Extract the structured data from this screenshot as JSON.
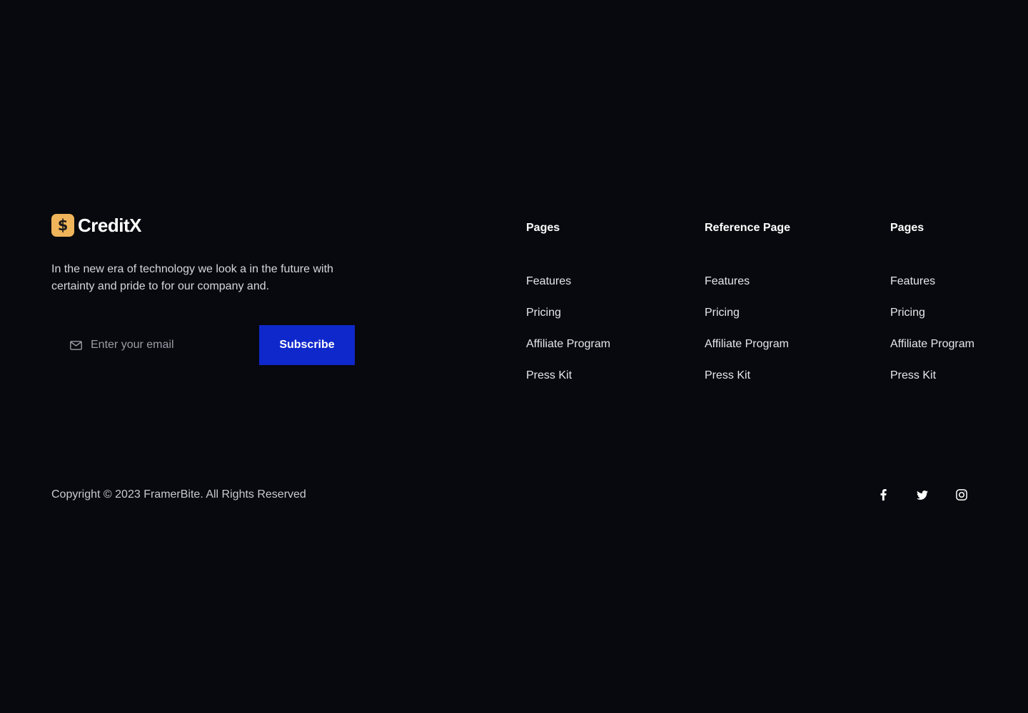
{
  "brand": {
    "logo_symbol": "$",
    "name": "CreditX",
    "tagline": "In the new era of technology we look a in the future with certainty and pride to for our company and.",
    "accent_color": "#f0b45a"
  },
  "newsletter": {
    "email_placeholder": "Enter your email",
    "email_value": "",
    "icon": "mail-icon",
    "subscribe_label": "Subscribe",
    "button_color": "#0f28cc"
  },
  "columns": [
    {
      "heading": "Pages",
      "links": [
        "Features",
        "Pricing",
        "Affiliate Program",
        "Press Kit"
      ]
    },
    {
      "heading": "Reference Page",
      "links": [
        "Features",
        "Pricing",
        "Affiliate Program",
        "Press Kit"
      ]
    },
    {
      "heading": "Pages",
      "links": [
        "Features",
        "Pricing",
        "Affiliate Program",
        "Press Kit"
      ]
    }
  ],
  "footer": {
    "copyright": "Copyright © 2023 FramerBite. All Rights Reserved",
    "socials": [
      "facebook-icon",
      "twitter-icon",
      "instagram-icon"
    ]
  },
  "colors": {
    "background": "#08090e",
    "text": "#ffffff"
  }
}
